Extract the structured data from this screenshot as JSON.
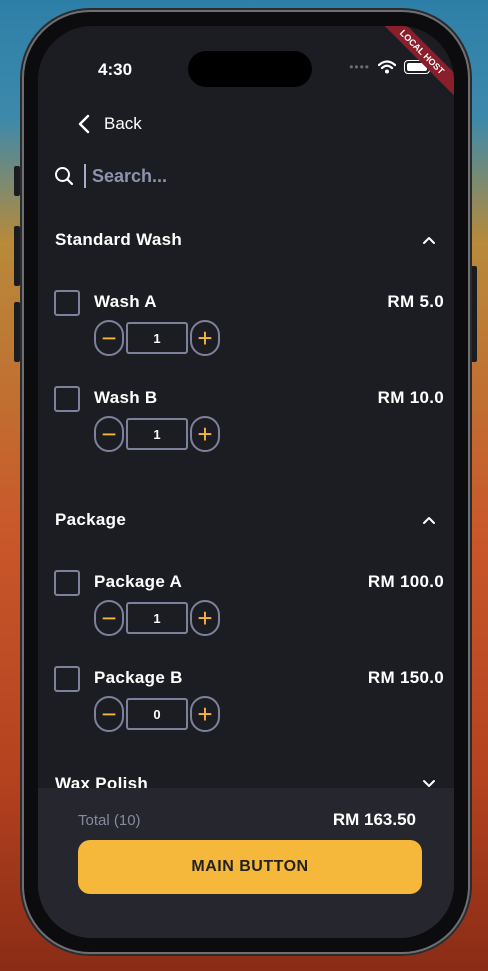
{
  "status": {
    "time": "4:30",
    "ribbon": "LOCAL HOST"
  },
  "nav": {
    "back_label": "Back"
  },
  "search": {
    "placeholder": "Search..."
  },
  "sections": [
    {
      "title": "Standard Wash",
      "expanded": true,
      "items": [
        {
          "name": "Wash A",
          "price": "RM 5.0",
          "qty": "1"
        },
        {
          "name": "Wash B",
          "price": "RM 10.0",
          "qty": "1"
        }
      ]
    },
    {
      "title": "Package",
      "expanded": true,
      "items": [
        {
          "name": "Package A",
          "price": "RM 100.0",
          "qty": "1"
        },
        {
          "name": "Package B",
          "price": "RM 150.0",
          "qty": "0"
        }
      ]
    },
    {
      "title": "Wax Polish",
      "expanded": false,
      "items": []
    }
  ],
  "footer": {
    "total_label": "Total (10)",
    "total_value": "RM 163.50",
    "main_button_label": "MAIN BUTTON"
  },
  "colors": {
    "accent": "#f6b83b",
    "background": "#1c1d22",
    "border": "#7d819b",
    "footer": "#25262e"
  },
  "icons": {
    "back": "chevron-left-icon",
    "search": "search-icon",
    "expand": "chevron-up-icon",
    "collapse": "chevron-down-icon"
  }
}
